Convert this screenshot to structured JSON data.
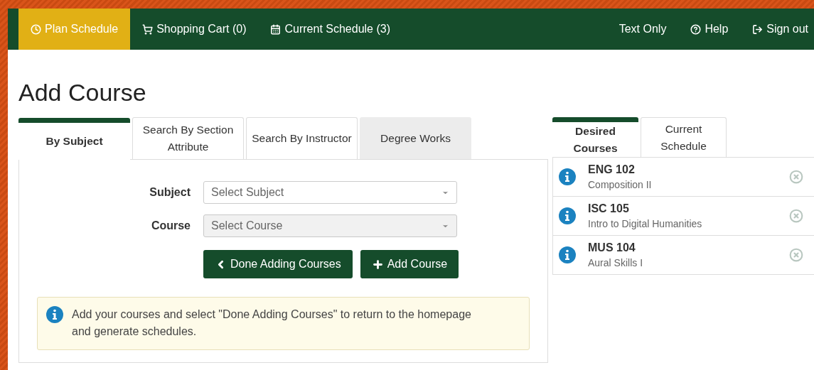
{
  "nav": {
    "left": [
      {
        "label": "Plan Schedule",
        "kind": "clock",
        "selected": true
      },
      {
        "label": "Shopping Cart (0)",
        "kind": "cart",
        "selected": false
      },
      {
        "label": "Current Schedule (3)",
        "kind": "calendar",
        "selected": false
      }
    ],
    "right": [
      {
        "label": "Text Only",
        "kind": "plain"
      },
      {
        "label": "Help",
        "kind": "help"
      },
      {
        "label": "Sign out",
        "kind": "signout"
      }
    ]
  },
  "title": "Add Course",
  "search_tabs": [
    {
      "label": "By Subject",
      "selected": true,
      "kind": "tab"
    },
    {
      "label": "Search By Section Attribute",
      "selected": false,
      "kind": "tab"
    },
    {
      "label": "Search By Instructor",
      "selected": false,
      "kind": "tab"
    },
    {
      "label": "Degree Works",
      "selected": false,
      "kind": "link"
    }
  ],
  "fields": [
    {
      "label": "Subject",
      "placeholder": "Select Subject",
      "disabled": false
    },
    {
      "label": "Course",
      "placeholder": "Select Course",
      "disabled": true
    }
  ],
  "buttons": [
    {
      "label": "Done Adding Courses",
      "kind": "back"
    },
    {
      "label": "Add Course",
      "kind": "plus"
    }
  ],
  "notice": "Add your courses and select \"Done Adding Courses\" to return to the homepage and generate schedules.",
  "course_tabs": [
    {
      "label": "Desired Courses",
      "selected": true
    },
    {
      "label": "Current Schedule",
      "selected": false
    }
  ],
  "courses": [
    {
      "code": "ENG 102",
      "name": "Composition II"
    },
    {
      "code": "ISC 105",
      "name": "Intro to Digital Humanities"
    },
    {
      "code": "MUS 104",
      "name": "Aural Skills I"
    }
  ]
}
